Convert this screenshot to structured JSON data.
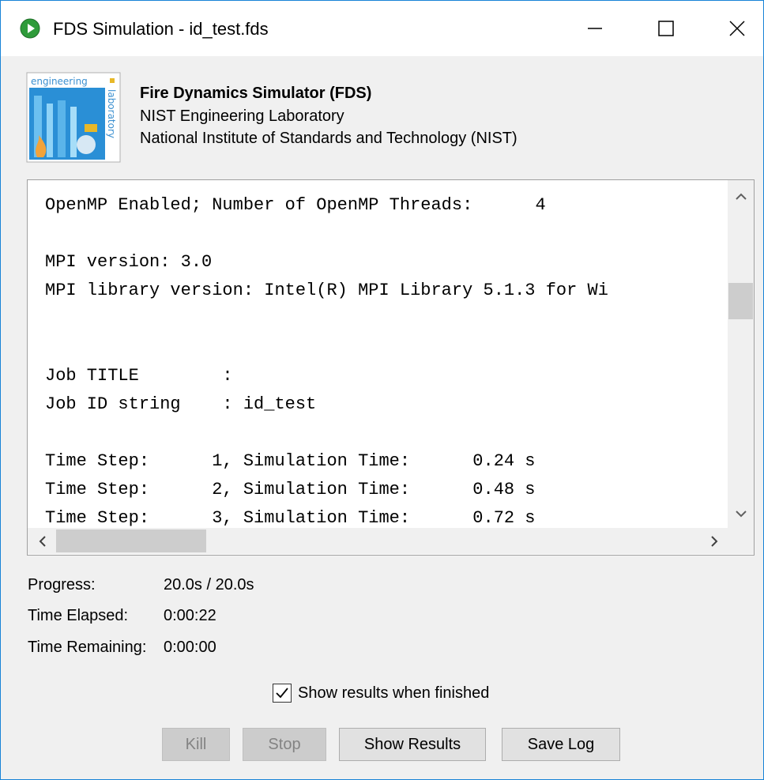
{
  "window": {
    "title": "FDS Simulation - id_test.fds"
  },
  "header": {
    "title": "Fire Dynamics Simulator (FDS)",
    "line1": "NIST Engineering Laboratory",
    "line2": "National Institute of Standards and Technology (NIST)",
    "logo_text_top": "engineering",
    "logo_text_side": "laboratory"
  },
  "log": {
    "lines": [
      "OpenMP Enabled; Number of OpenMP Threads:      4",
      "",
      "MPI version: 3.0",
      "MPI library version: Intel(R) MPI Library 5.1.3 for Wi",
      "",
      "",
      "Job TITLE        :",
      "Job ID string    : id_test",
      "",
      "Time Step:      1, Simulation Time:      0.24 s",
      "Time Step:      2, Simulation Time:      0.48 s",
      "Time Step:      3, Simulation Time:      0.72 s"
    ]
  },
  "status": {
    "progress_label": "Progress:",
    "progress_value": "20.0s / 20.0s",
    "elapsed_label": "Time Elapsed:",
    "elapsed_value": "0:00:22",
    "remaining_label": "Time Remaining:",
    "remaining_value": "0:00:00"
  },
  "options": {
    "show_results_label": "Show results when finished",
    "show_results_checked": true
  },
  "buttons": {
    "kill": "Kill",
    "stop": "Stop",
    "show_results": "Show Results",
    "save_log": "Save Log"
  },
  "colors": {
    "window_border": "#1883d7",
    "app_icon": "#2e9b3a"
  }
}
